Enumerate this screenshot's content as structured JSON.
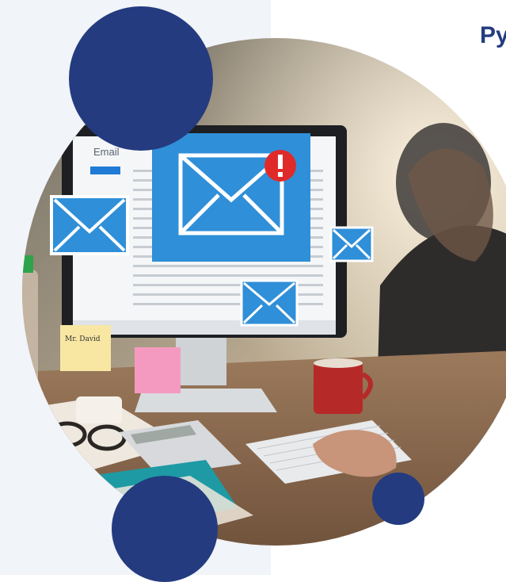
{
  "heading": {
    "text": "Py"
  },
  "screen": {
    "app_title": "Email"
  },
  "sticky_note": {
    "text": "Mr. David"
  },
  "colors": {
    "brand_navy": "#243b80",
    "mail_blue": "#2f8fd8",
    "alert_red": "#e02a2a",
    "sticky_yellow": "#f7e7a3",
    "sticky_pink": "#f49ac0"
  },
  "icons": [
    "envelope-alert-icon",
    "envelope-icon"
  ]
}
